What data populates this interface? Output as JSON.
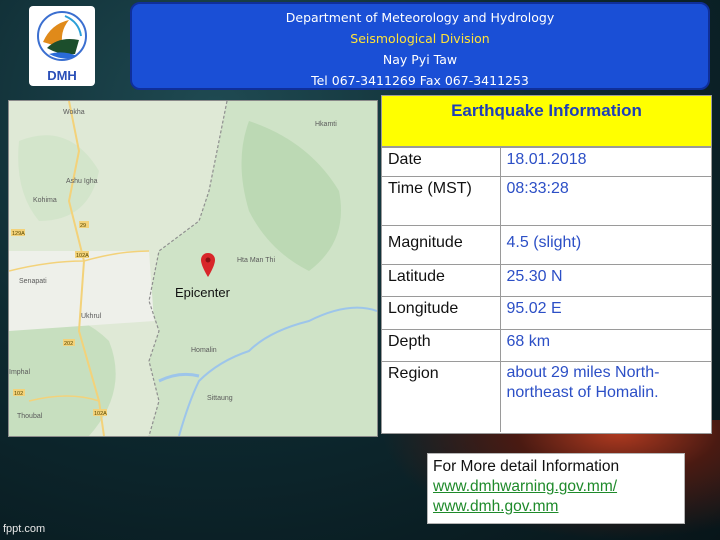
{
  "header": {
    "line1": "Department of Meteorology and Hydrology",
    "line2": "Seismological Division",
    "line3": "Nay Pyi Taw",
    "line4": "Tel 067-3411269 Fax 067-3411253"
  },
  "logo": {
    "text": "DMH"
  },
  "map": {
    "epicenter_label": "Epicenter",
    "towns": [
      "Wokha",
      "Ashu Igha",
      "Kohima",
      "Senapati",
      "Ukhrul",
      "Imphal",
      "Thoubal",
      "Hkamti",
      "Hta Man Thi",
      "Homalin",
      "Sittaung"
    ],
    "road_badges": [
      "29",
      "129A",
      "102A",
      "202",
      "102",
      "102A"
    ]
  },
  "info": {
    "title": "Earthquake Information",
    "rows": [
      {
        "key": "Date",
        "value": "18.01.2018"
      },
      {
        "key": "Time (MST)",
        "value": "08:33:28"
      },
      {
        "key": "Magnitude",
        "value": "4.5 (slight)"
      },
      {
        "key": "Latitude",
        "value": "25.30 N"
      },
      {
        "key": "Longitude",
        "value": "95.02 E"
      },
      {
        "key": "Depth",
        "value": "68 km"
      },
      {
        "key": "Region",
        "value": "about 29 miles North-northeast of  Homalin."
      }
    ]
  },
  "more": {
    "title": "For More detail Information",
    "link1": "www.dmhwarning.gov.mm/",
    "link2": "www.dmh.gov.mm"
  },
  "watermark": "fppt.com",
  "colors": {
    "header_bg": "#1a4fd6",
    "title_bg": "#ffff00",
    "value_text": "#2c4fc6",
    "pin": "#d8262a"
  }
}
